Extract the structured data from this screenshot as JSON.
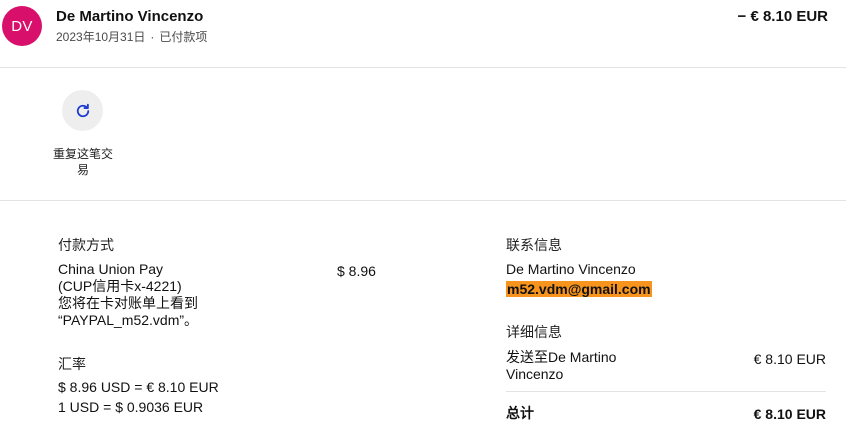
{
  "header": {
    "avatar_initials": "DV",
    "merchant": "De Martino Vincenzo",
    "date": "2023年10月31日",
    "separator": "·",
    "status": "已付款项",
    "amount": "− € 8.10 EUR"
  },
  "actions": {
    "repeat_label": "重复这笔交易"
  },
  "payment": {
    "title": "付款方式",
    "method_line1": "China Union Pay",
    "method_line2": "(CUP信用卡x-4221)",
    "statement_line1": "您将在卡对账单上看到",
    "statement_line2": "“PAYPAL_m52.vdm”。",
    "amount": "$ 8.96"
  },
  "exchange": {
    "title": "汇率",
    "line1": "$ 8.96 USD = € 8.10 EUR",
    "line2": "1 USD = $ 0.9036 EUR"
  },
  "contact": {
    "title": "联系信息",
    "name": "De Martino Vincenzo",
    "email": "m52.vdm@gmail.com"
  },
  "details": {
    "title": "详细信息",
    "sent_to_line1": "发送至De Martino",
    "sent_to_line2": "Vincenzo",
    "sent_amount": "€ 8.10 EUR",
    "total_label": "总计",
    "total_amount": "€ 8.10 EUR"
  },
  "colors": {
    "avatar_bg": "#d8106b",
    "email_highlight": "#f7941d",
    "repeat_icon": "#1f3bd1"
  },
  "icons": {
    "repeat": "refresh-icon"
  }
}
